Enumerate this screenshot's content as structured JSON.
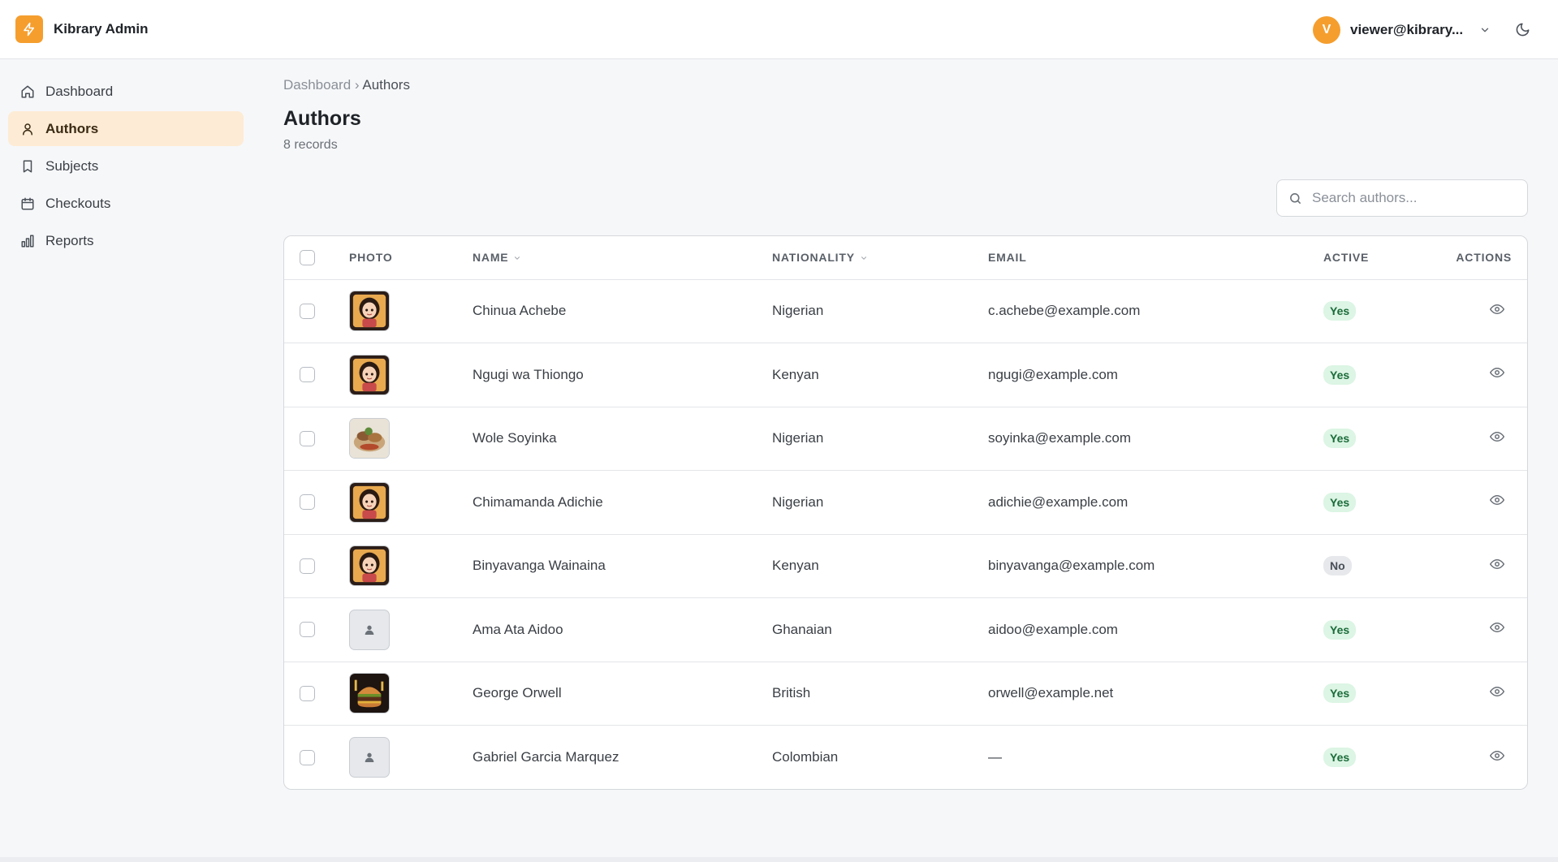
{
  "app": {
    "title": "Kibrary Admin"
  },
  "user": {
    "initial": "V",
    "email": "viewer@kibrary..."
  },
  "colors": {
    "accent": "#f59e2e",
    "active_bg": "#fdebd5",
    "yes_bg": "#dcf5e4",
    "yes_text": "#1b6b3a"
  },
  "sidebar": {
    "items": [
      {
        "label": "Dashboard",
        "icon": "home-icon",
        "active": false
      },
      {
        "label": "Authors",
        "icon": "user-icon",
        "active": true
      },
      {
        "label": "Subjects",
        "icon": "bookmark-icon",
        "active": false
      },
      {
        "label": "Checkouts",
        "icon": "calendar-icon",
        "active": false
      },
      {
        "label": "Reports",
        "icon": "bar-chart-icon",
        "active": false
      }
    ]
  },
  "breadcrumb": {
    "parent": "Dashboard",
    "separator": "›",
    "current": "Authors"
  },
  "page": {
    "title": "Authors",
    "count": "8 records"
  },
  "search": {
    "placeholder": "Search authors...",
    "value": ""
  },
  "table": {
    "headers": {
      "photo": "PHOTO",
      "name": "NAME",
      "nationality": "NATIONALITY",
      "email": "EMAIL",
      "active": "ACTIVE",
      "actions": "ACTIONS"
    },
    "rows": [
      {
        "name": "Chinua Achebe",
        "nationality": "Nigerian",
        "email": "c.achebe@example.com",
        "active": "Yes",
        "photo": "cartoon-portrait-icon"
      },
      {
        "name": "Ngugi wa Thiongo",
        "nationality": "Kenyan",
        "email": "ngugi@example.com",
        "active": "Yes",
        "photo": "cartoon-portrait-icon"
      },
      {
        "name": "Wole Soyinka",
        "nationality": "Nigerian",
        "email": "soyinka@example.com",
        "active": "Yes",
        "photo": "food-photo-icon"
      },
      {
        "name": "Chimamanda Adichie",
        "nationality": "Nigerian",
        "email": "adichie@example.com",
        "active": "Yes",
        "photo": "cartoon-portrait-icon"
      },
      {
        "name": "Binyavanga Wainaina",
        "nationality": "Kenyan",
        "email": "binyavanga@example.com",
        "active": "No",
        "photo": "cartoon-portrait-icon"
      },
      {
        "name": "Ama Ata Aidoo",
        "nationality": "Ghanaian",
        "email": "aidoo@example.com",
        "active": "Yes",
        "photo": "person-placeholder-icon"
      },
      {
        "name": "George Orwell",
        "nationality": "British",
        "email": "orwell@example.net",
        "active": "Yes",
        "photo": "burger-photo-icon"
      },
      {
        "name": "Gabriel Garcia Marquez",
        "nationality": "Colombian",
        "email": "—",
        "active": "Yes",
        "photo": "person-placeholder-icon"
      }
    ]
  }
}
